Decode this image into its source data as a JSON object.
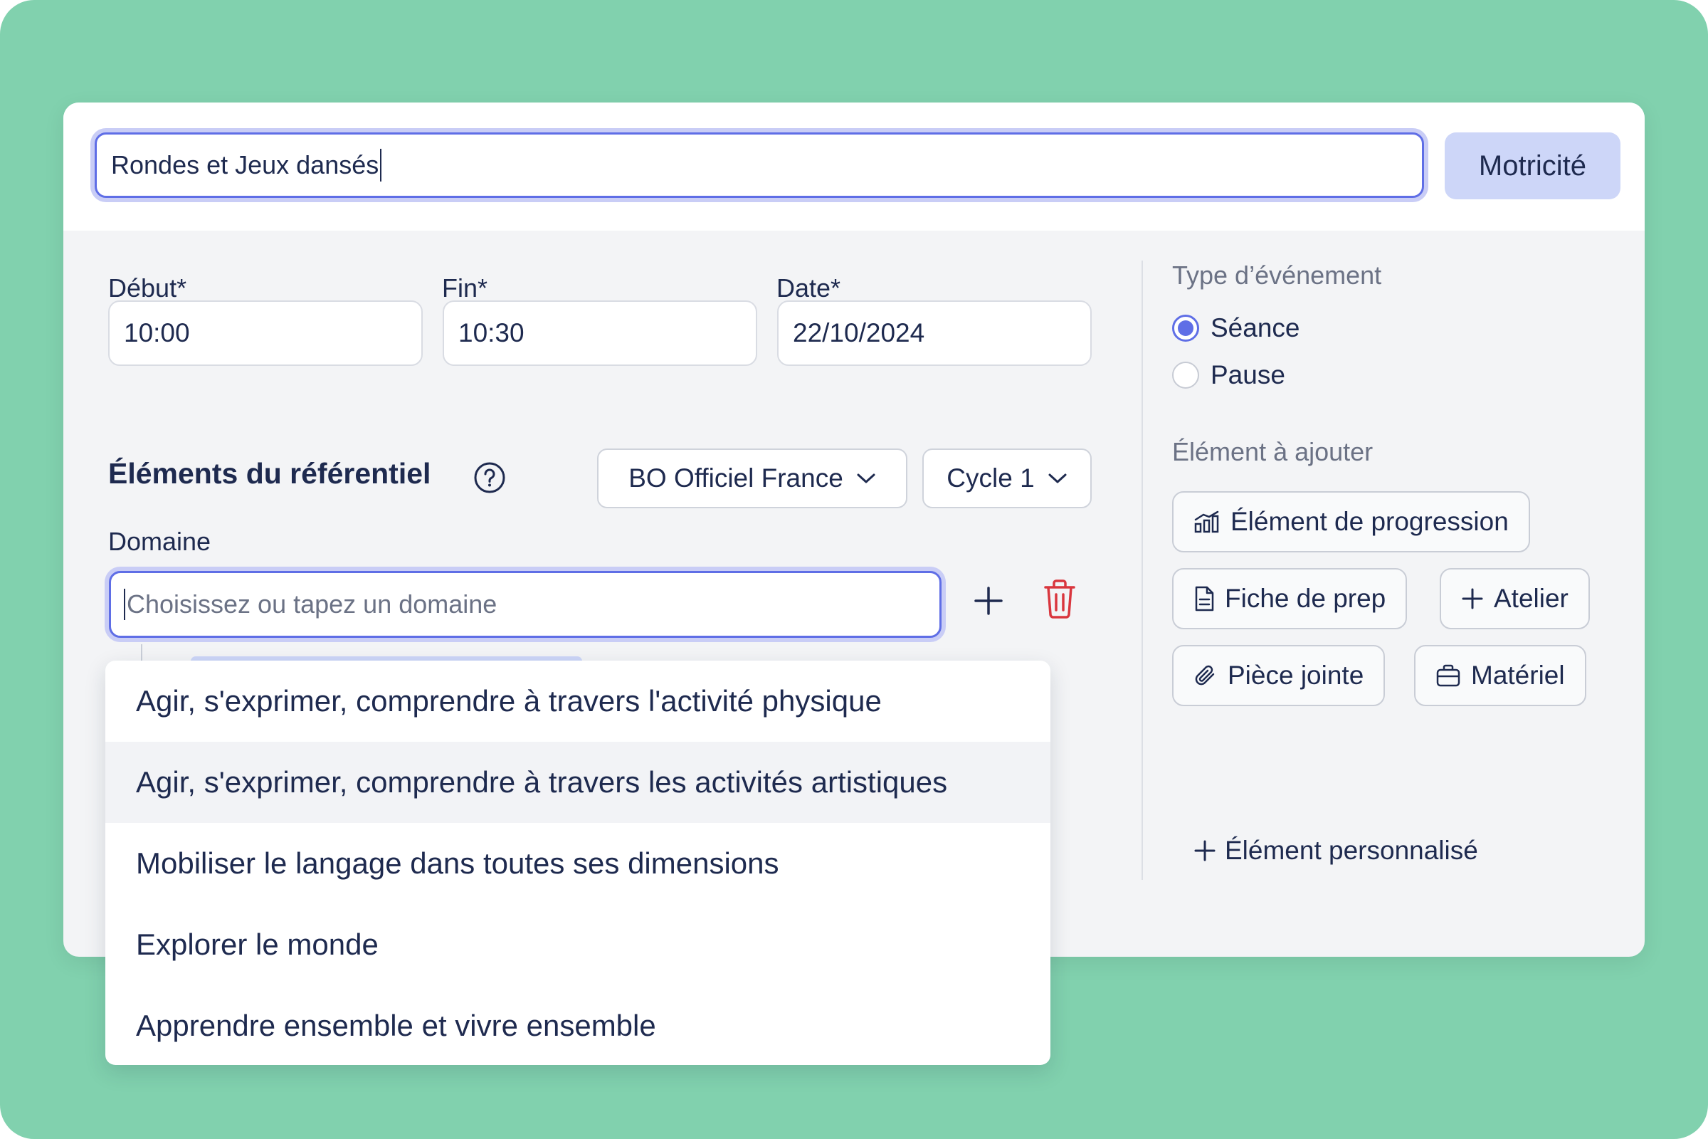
{
  "event": {
    "title_value": "Rondes et Jeux dansés",
    "subject_label": "Motricité"
  },
  "times": {
    "start_label": "Début*",
    "start_value": "10:00",
    "end_label": "Fin*",
    "end_value": "10:30",
    "date_label": "Date*",
    "date_value": "22/10/2024"
  },
  "referentiel": {
    "title": "Éléments du référentiel",
    "help_icon": "question-circle-icon",
    "program_select": "BO Officiel France",
    "cycle_select": "Cycle 1",
    "domain_label": "Domaine",
    "domain_placeholder": "Choisissez ou tapez un domaine",
    "domain_value": ""
  },
  "dropdown": {
    "items": [
      "Agir, s'exprimer, comprendre à travers l'activité physique",
      "Agir, s'exprimer, comprendre à travers les activités artistiques",
      "Mobiliser le langage dans toutes ses dimensions",
      "Explorer le monde",
      "Apprendre ensemble et vivre ensemble"
    ],
    "hovered_index": 1
  },
  "sidebar": {
    "event_type_label": "Type d’événement",
    "event_types": [
      {
        "label": "Séance",
        "checked": true
      },
      {
        "label": "Pause",
        "checked": false
      }
    ],
    "add_label": "Élément à ajouter",
    "add_buttons": {
      "progression": "Élément de progression",
      "prep_sheet": "Fiche de prep",
      "workshop": "Atelier",
      "attachment": "Pièce jointe",
      "material": "Matériel",
      "custom": "Élément personnalisé"
    }
  },
  "colors": {
    "background": "#81d1ae",
    "accent": "#5f6ee6",
    "accent_soft": "#cdd6f8",
    "text": "#1e2a4f",
    "danger": "#d9363e"
  }
}
